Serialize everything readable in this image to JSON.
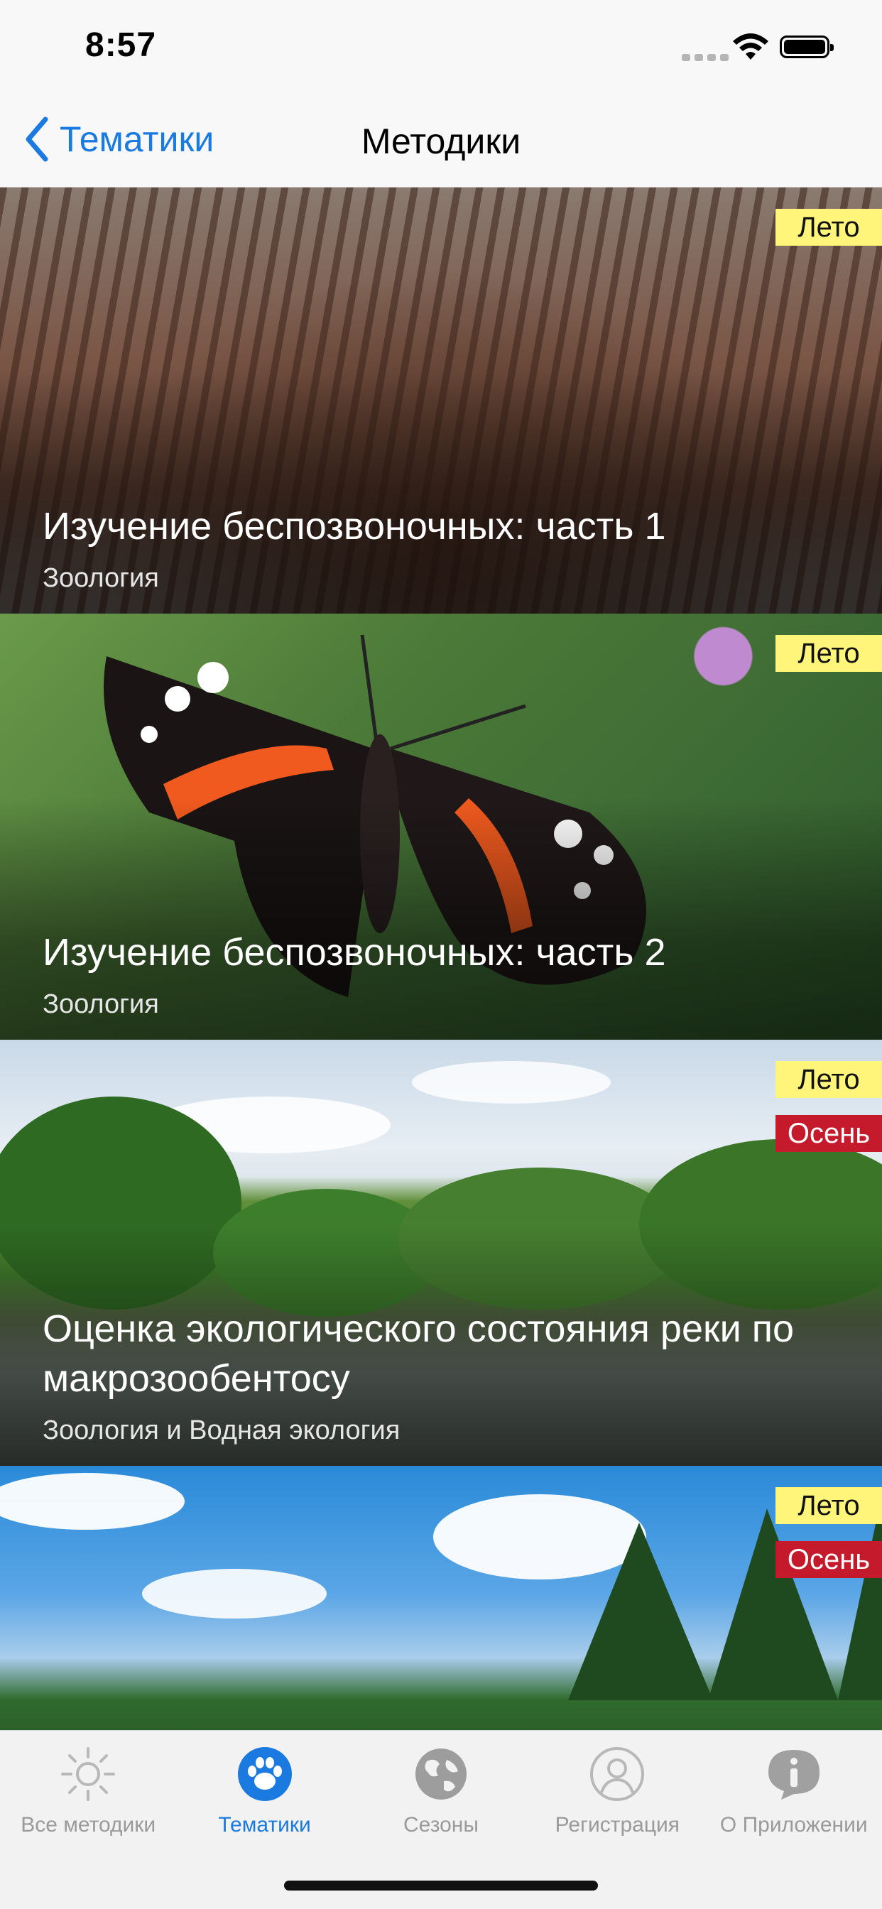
{
  "status_bar": {
    "time": "8:57"
  },
  "nav": {
    "back_label": "Тематики",
    "title": "Методики"
  },
  "cards": [
    {
      "title": "Изучение беспозвоночных: часть 1",
      "subtitle": "Зоология",
      "tags": [
        "Лето"
      ]
    },
    {
      "title": "Изучение беспозвоночных: часть 2",
      "subtitle": "Зоология",
      "tags": [
        "Лето"
      ]
    },
    {
      "title": "Оценка экологического состояния реки по макрозообентосу",
      "subtitle": "Зоология и Водная экология",
      "tags": [
        "Лето",
        "Осень"
      ]
    },
    {
      "title": "",
      "subtitle": "",
      "tags": [
        "Лето",
        "Осень"
      ]
    }
  ],
  "tabs": [
    {
      "label": "Все методики",
      "icon": "sun-icon",
      "active": false
    },
    {
      "label": "Тематики",
      "icon": "paw-icon",
      "active": true
    },
    {
      "label": "Сезоны",
      "icon": "globe-icon",
      "active": false
    },
    {
      "label": "Регистрация",
      "icon": "user-icon",
      "active": false
    },
    {
      "label": "О Приложении",
      "icon": "info-icon",
      "active": false
    }
  ],
  "colors": {
    "accent": "#1a7ae0",
    "summer_tag": "#fff57a",
    "autumn_tag": "#c41a2c"
  }
}
